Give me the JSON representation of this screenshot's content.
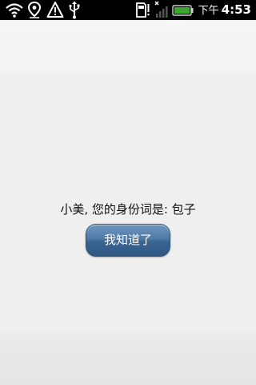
{
  "status_bar": {
    "ampm": "下午",
    "time": "4:53",
    "icons": [
      "wifi-icon",
      "location-pin-icon",
      "warning-icon",
      "usb-icon",
      "sd-card-icon",
      "signal-icon",
      "battery-icon"
    ],
    "battery_color": "#3aa82a"
  },
  "dialog": {
    "message": "小美, 您的身份词是: 包子",
    "button_label": "我知道了",
    "button_color": "#46709c"
  }
}
